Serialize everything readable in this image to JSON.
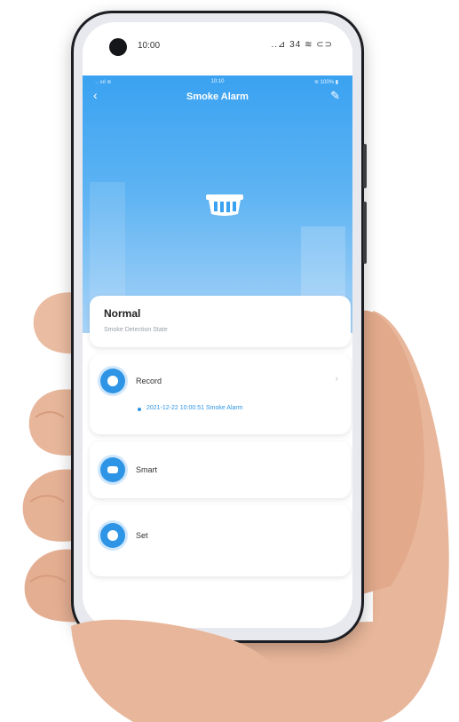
{
  "device_status_bar": {
    "time": "10:00",
    "icons": "..⊿ 34 ≋ ⊂⊃"
  },
  "app_status_bar": {
    "left": "·. ıııl ≋",
    "center": "10:10",
    "right": "≋ 100% ▮"
  },
  "nav": {
    "back_icon": "back-chevron-icon",
    "title": "Smoke Alarm",
    "edit_icon": "edit-pencil-icon"
  },
  "status_card": {
    "title": "Normal",
    "subtitle": "Smoke Detection State"
  },
  "record_card": {
    "label": "Record",
    "chevron": "›",
    "entry": "2021-12-22 10:00:51 Smoke Alarm"
  },
  "smart_card": {
    "label": "Smart"
  },
  "set_card": {
    "label": "Set"
  },
  "colors": {
    "accent_blue": "#2e95e6",
    "header_blue": "#3aa2f1"
  }
}
